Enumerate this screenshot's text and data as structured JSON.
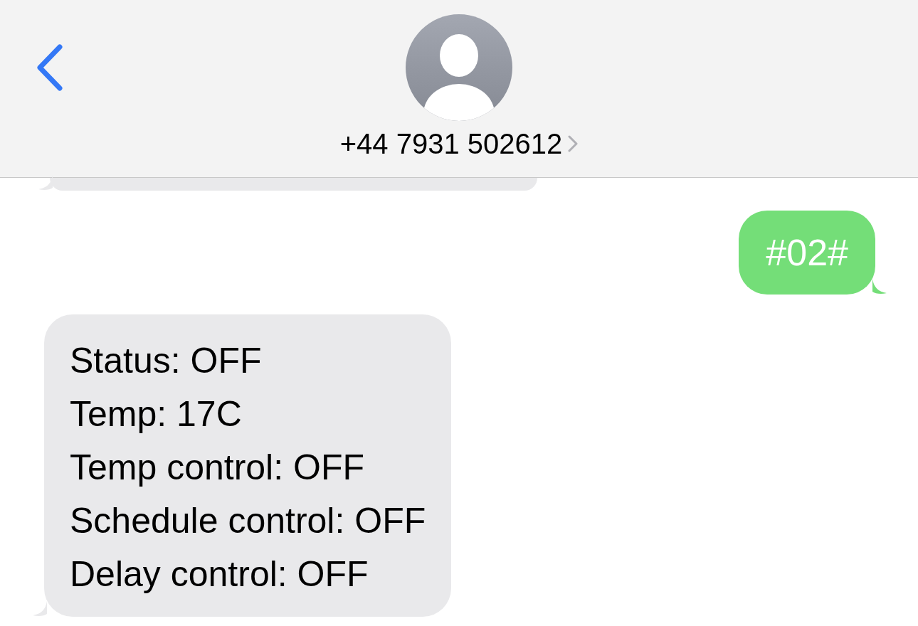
{
  "header": {
    "contact": "+44 7931 502612"
  },
  "messages": [
    {
      "kind": "cut_off"
    },
    {
      "kind": "sent",
      "lines": [
        "#02#"
      ]
    },
    {
      "kind": "received",
      "lines": [
        "Status: OFF",
        "Temp: 17C",
        "Temp control: OFF",
        "Schedule control: OFF",
        "Delay control: OFF"
      ]
    }
  ]
}
